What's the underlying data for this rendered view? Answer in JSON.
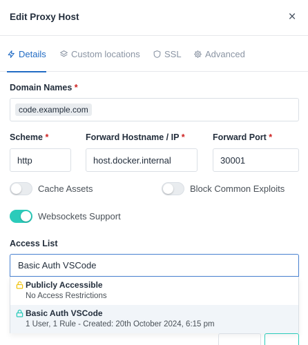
{
  "dialog": {
    "title": "Edit Proxy Host",
    "close_glyph": "×"
  },
  "tabs": [
    {
      "label": "Details",
      "icon": "bolt-icon",
      "active": true
    },
    {
      "label": "Custom locations",
      "icon": "layers-icon",
      "active": false
    },
    {
      "label": "SSL",
      "icon": "shield-icon",
      "active": false
    },
    {
      "label": "Advanced",
      "icon": "gear-icon",
      "active": false
    }
  ],
  "form": {
    "domain_names": {
      "label": "Domain Names",
      "required": "*",
      "values": [
        "code.example.com"
      ]
    },
    "scheme": {
      "label": "Scheme",
      "required": "*",
      "value": "http"
    },
    "forward_hostname": {
      "label": "Forward Hostname / IP",
      "required": "*",
      "value": "host.docker.internal"
    },
    "forward_port": {
      "label": "Forward Port",
      "required": "*",
      "value": "30001"
    },
    "cache_assets": {
      "label": "Cache Assets",
      "checked": false
    },
    "block_exploits": {
      "label": "Block Common Exploits",
      "checked": false
    },
    "websockets": {
      "label": "Websockets Support",
      "checked": true
    },
    "access_list": {
      "label": "Access List",
      "value": "Basic Auth VSCode",
      "options": [
        {
          "title": "Publicly Accessible",
          "subtitle": "No Access Restrictions",
          "icon": "lock-open-icon",
          "icon_color": "#f1c40f",
          "highlighted": false
        },
        {
          "title": "Basic Auth VSCode",
          "subtitle": "1 User, 1 Rule - Created: 20th October 2024, 6:15 pm",
          "icon": "lock-icon",
          "icon_color": "#2bcbba",
          "highlighted": true
        }
      ]
    }
  },
  "colors": {
    "accent": "#206bc4",
    "toggle_on": "#2bcbba",
    "required": "#cd201f",
    "focus_border": "#467fcf"
  }
}
